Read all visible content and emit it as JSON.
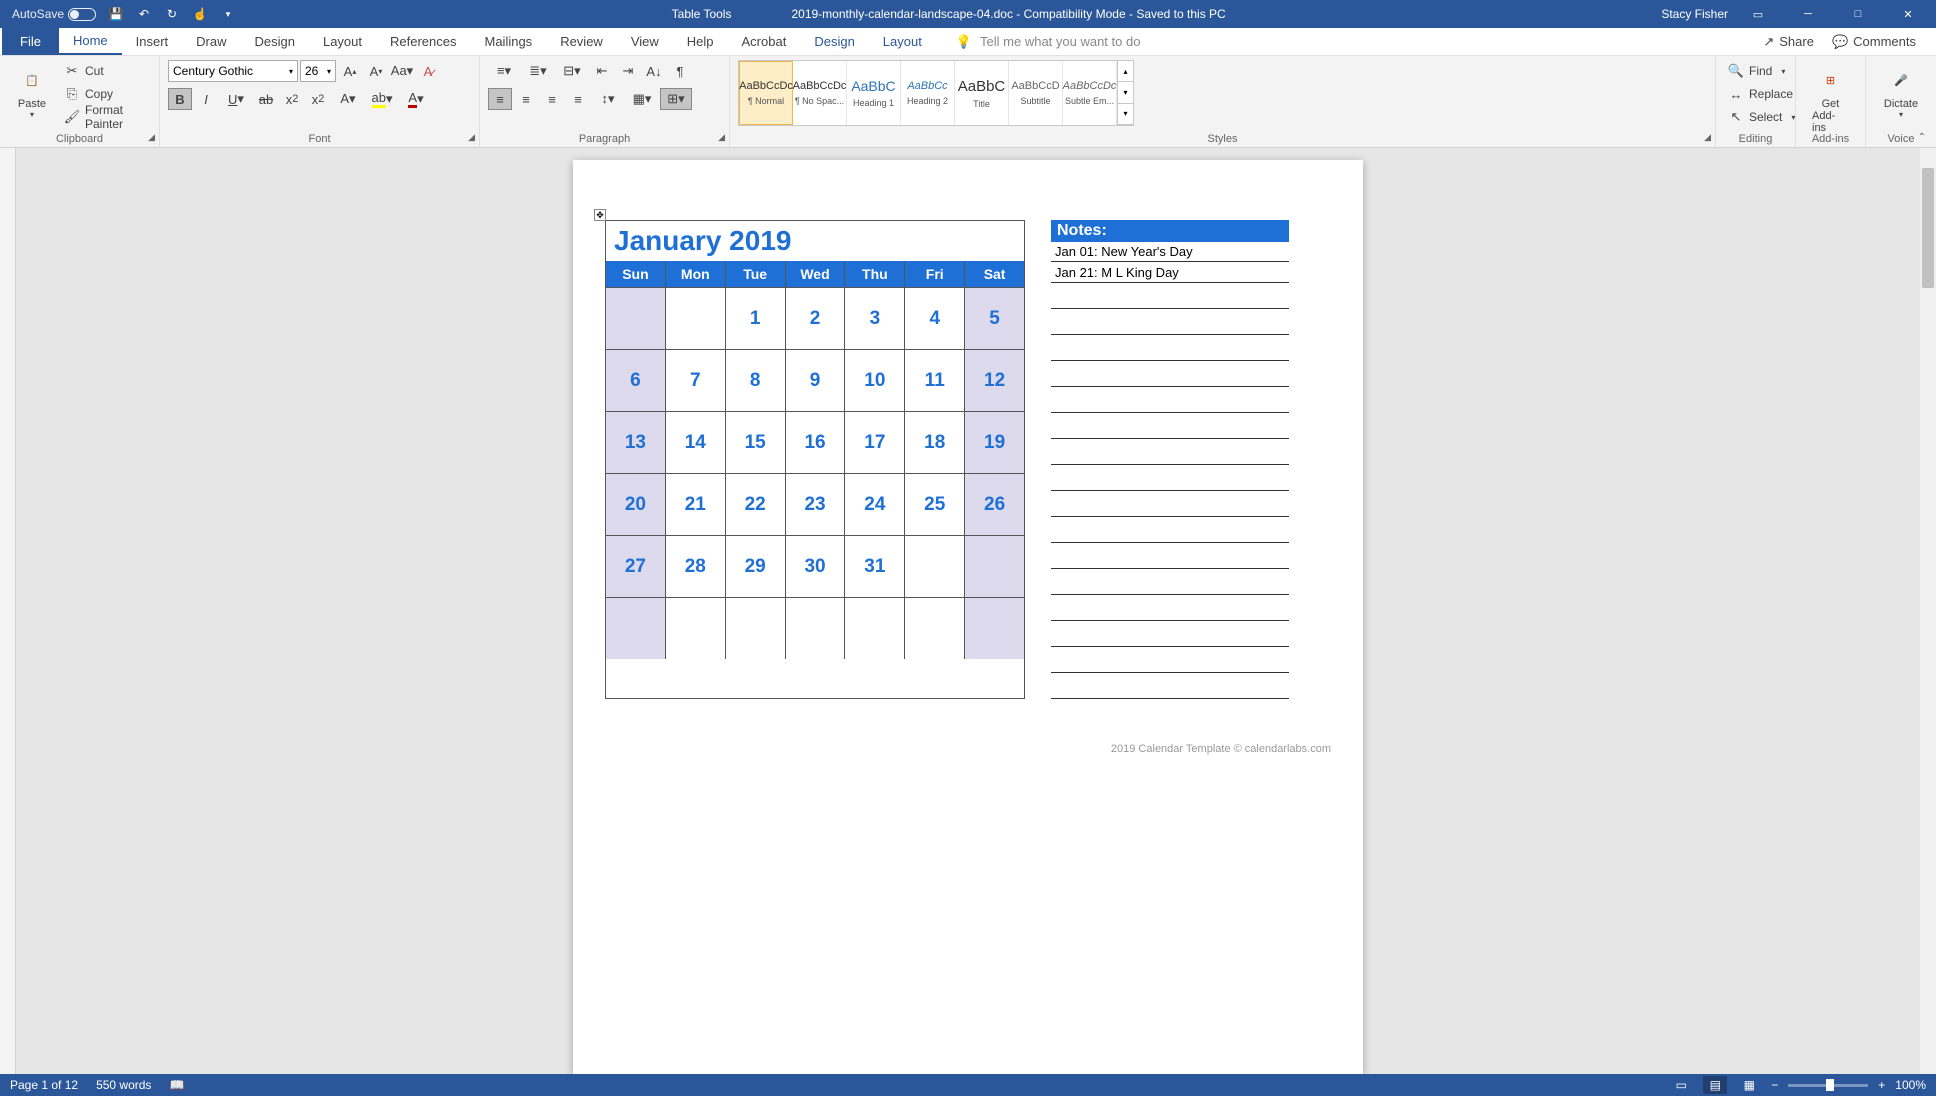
{
  "titlebar": {
    "autosave": "AutoSave",
    "table_tools": "Table Tools",
    "doc_title": "2019-monthly-calendar-landscape-04.doc  -  Compatibility Mode  -  Saved to this PC",
    "user": "Stacy Fisher"
  },
  "tabs": {
    "file": "File",
    "home": "Home",
    "insert": "Insert",
    "draw": "Draw",
    "design": "Design",
    "layout": "Layout",
    "references": "References",
    "mailings": "Mailings",
    "review": "Review",
    "view": "View",
    "help": "Help",
    "acrobat": "Acrobat",
    "tt_design": "Design",
    "tt_layout": "Layout",
    "tellme": "Tell me what you want to do",
    "share": "Share",
    "comments": "Comments"
  },
  "ribbon": {
    "clipboard": {
      "paste": "Paste",
      "cut": "Cut",
      "copy": "Copy",
      "format_painter": "Format Painter",
      "label": "Clipboard"
    },
    "font": {
      "name": "Century Gothic",
      "size": "26",
      "label": "Font"
    },
    "paragraph": {
      "label": "Paragraph"
    },
    "styles": {
      "items": [
        {
          "preview": "AaBbCcDc",
          "name": "¶ Normal"
        },
        {
          "preview": "AaBbCcDc",
          "name": "¶ No Spac..."
        },
        {
          "preview": "AaBbC",
          "name": "Heading 1"
        },
        {
          "preview": "AaBbCc",
          "name": "Heading 2"
        },
        {
          "preview": "AaBbC",
          "name": "Title"
        },
        {
          "preview": "AaBbCcD",
          "name": "Subtitle"
        },
        {
          "preview": "AaBbCcDc",
          "name": "Subtle Em..."
        }
      ],
      "label": "Styles"
    },
    "editing": {
      "find": "Find",
      "replace": "Replace",
      "select": "Select",
      "label": "Editing"
    },
    "addins": {
      "get": "Get",
      "addins": "Add-ins",
      "label": "Add-ins"
    },
    "voice": {
      "dictate": "Dictate",
      "label": "Voice"
    }
  },
  "calendar": {
    "title": "January 2019",
    "days": [
      "Sun",
      "Mon",
      "Tue",
      "Wed",
      "Thu",
      "Fri",
      "Sat"
    ],
    "rows": [
      [
        "",
        "",
        "1",
        "2",
        "3",
        "4",
        "5"
      ],
      [
        "6",
        "7",
        "8",
        "9",
        "10",
        "11",
        "12"
      ],
      [
        "13",
        "14",
        "15",
        "16",
        "17",
        "18",
        "19"
      ],
      [
        "20",
        "21",
        "22",
        "23",
        "24",
        "25",
        "26"
      ],
      [
        "27",
        "28",
        "29",
        "30",
        "31",
        "",
        ""
      ],
      [
        "",
        "",
        "",
        "",
        "",
        "",
        ""
      ]
    ]
  },
  "notes": {
    "header": "Notes:",
    "lines": [
      "Jan 01: New Year's Day",
      "Jan 21: M L King Day"
    ]
  },
  "footer_credit": "2019 Calendar Template © calendarlabs.com",
  "status": {
    "page": "Page 1 of 12",
    "words": "550 words",
    "zoom": "100%"
  }
}
